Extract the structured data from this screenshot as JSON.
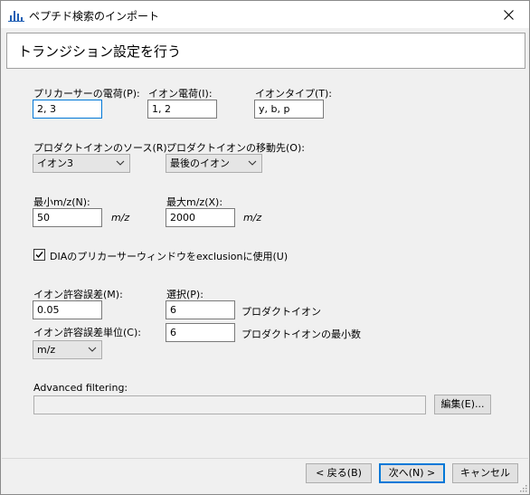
{
  "window": {
    "title": "ペプチド検索のインポート"
  },
  "header": {
    "title": "トランジション設定を行う"
  },
  "precursor_charges": {
    "label": "プリカーサーの電荷(P):",
    "value": "2, 3"
  },
  "ion_charges": {
    "label": "イオン電荷(I):",
    "value": "1, 2"
  },
  "ion_types": {
    "label": "イオンタイプ(T):",
    "value": "y, b, p"
  },
  "product_ion_source": {
    "label": "プロダクトイオンのソース(R):",
    "value": "イオン3"
  },
  "product_ion_destination": {
    "label": "プロダクトイオンの移動先(O):",
    "value": "最後のイオン"
  },
  "min_mz": {
    "label": "最小m/z(N):",
    "value": "50",
    "unit": "m/z"
  },
  "max_mz": {
    "label": "最大m/z(X):",
    "value": "2000",
    "unit": "m/z"
  },
  "dia_exclusion": {
    "label": "DIAのプリカーサーウィンドウをexclusionに使用(U)",
    "checked": true
  },
  "ion_tolerance": {
    "label": "イオン許容誤差(M):",
    "value": "0.05"
  },
  "tolerance_unit": {
    "label": "イオン許容誤差単位(C):",
    "value": "m/z"
  },
  "pick": {
    "label": "選択(P):",
    "product_ions_value": "6",
    "product_ions_label": "プロダクトイオン",
    "min_product_ions_value": "6",
    "min_product_ions_label": "プロダクトイオンの最小数"
  },
  "advanced_filtering": {
    "label": "Advanced filtering:",
    "value": "",
    "edit_label": "編集(E)..."
  },
  "footer": {
    "back_label": "< 戻る(B)",
    "next_label": "次へ(N) >",
    "cancel_label": "キャンセル"
  },
  "colors": {
    "window_bg": "#f0f0f0",
    "focus_border": "#0078d7",
    "button_bg": "#e1e1e1"
  }
}
